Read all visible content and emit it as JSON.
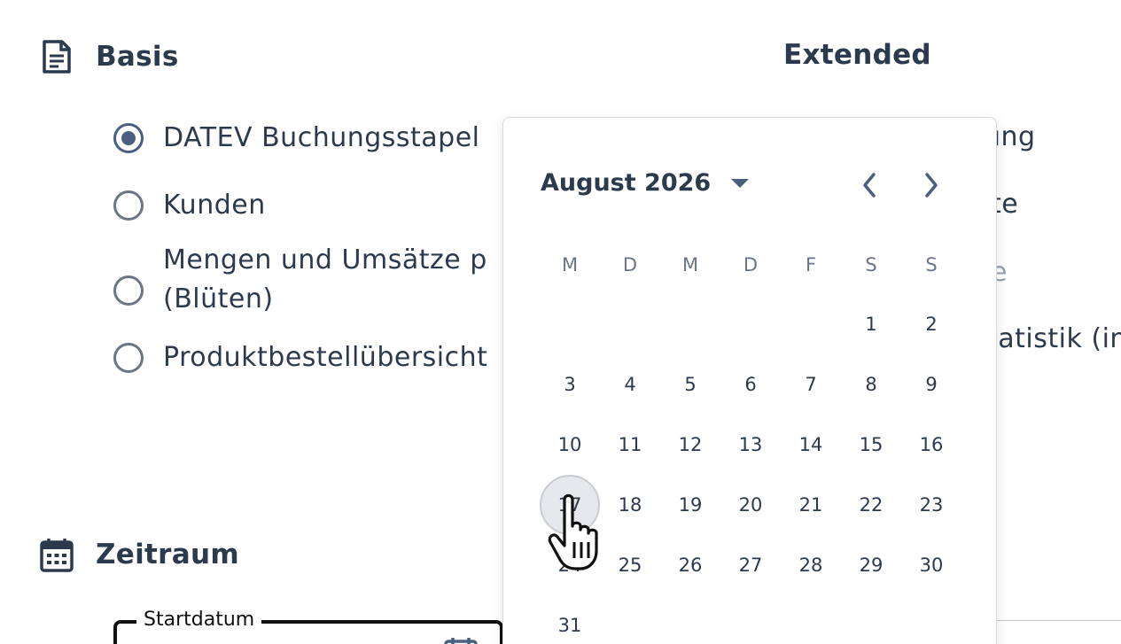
{
  "basis": {
    "title": "Basis",
    "icon": "document-icon",
    "options": [
      {
        "label": "DATEV Buchungsstapel",
        "checked": true
      },
      {
        "label": "Kunden",
        "checked": false
      },
      {
        "label": "Mengen und Umsätze p",
        "label2": "(Blüten)",
        "checked": false
      },
      {
        "label": "Produktbestellübersicht",
        "checked": false
      }
    ]
  },
  "extended": {
    "title": "Extended",
    "visible_fragments": [
      "ung",
      "te",
      "e",
      "tatistik (in"
    ]
  },
  "zeitraum": {
    "title": "Zeitraum",
    "icon": "calendar-icon",
    "start_label": "Startdatum"
  },
  "calendar": {
    "month_label": "August 2026",
    "weekdays": [
      "M",
      "D",
      "M",
      "D",
      "F",
      "S",
      "S"
    ],
    "first_weekday_index": 5,
    "days_in_month": 31,
    "hovered_day": 17
  },
  "colors": {
    "text": "#2c3a4d",
    "accent": "#4a5f80",
    "muted": "#6b7685"
  }
}
